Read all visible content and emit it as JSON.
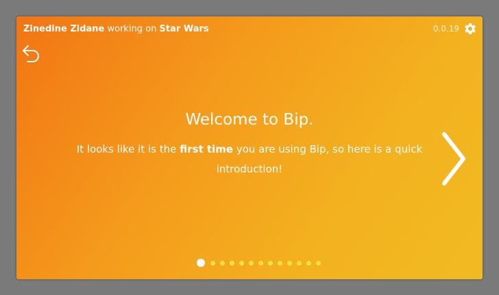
{
  "header": {
    "user_name": "Zinedine Zidane",
    "working_on": "working on",
    "project": "Star Wars",
    "version": "0.0.19"
  },
  "icons": {
    "settings": "gear-icon",
    "back": "back-arrow-icon",
    "next": "chevron-right-icon"
  },
  "slide": {
    "title": "Welcome to Bip.",
    "text_before": "It looks like it is the ",
    "text_bold": "first time",
    "text_after": " you are using Bip, so here is a quick introduction!"
  },
  "pager": {
    "total": 13,
    "active_index": 0
  },
  "colors": {
    "gradient_start": "#f27514",
    "gradient_end": "#f1bb22",
    "dot": "#fde046",
    "dot_active": "#ffffff"
  }
}
